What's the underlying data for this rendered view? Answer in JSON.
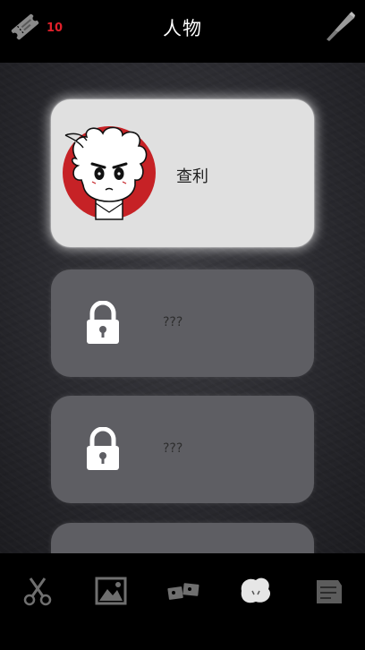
{
  "header": {
    "title": "人物",
    "ticket_count": "10",
    "ticket_icon": "ticket-icon",
    "tool_icon": "scalpel-icon"
  },
  "characters": [
    {
      "name": "查利",
      "locked": false
    },
    {
      "name": "???",
      "locked": true
    },
    {
      "name": "???",
      "locked": true
    },
    {
      "name": "",
      "locked": true
    }
  ],
  "bottom_nav": [
    {
      "icon": "scissors-icon",
      "active": false
    },
    {
      "icon": "photo-icon",
      "active": false
    },
    {
      "icon": "cards-icon",
      "active": false
    },
    {
      "icon": "characters-icon",
      "active": true
    },
    {
      "icon": "notes-icon",
      "active": false
    }
  ],
  "colors": {
    "accent_red": "#e0202a",
    "card_unlocked": "#e0e0e0",
    "card_locked": "#5e5e63"
  }
}
